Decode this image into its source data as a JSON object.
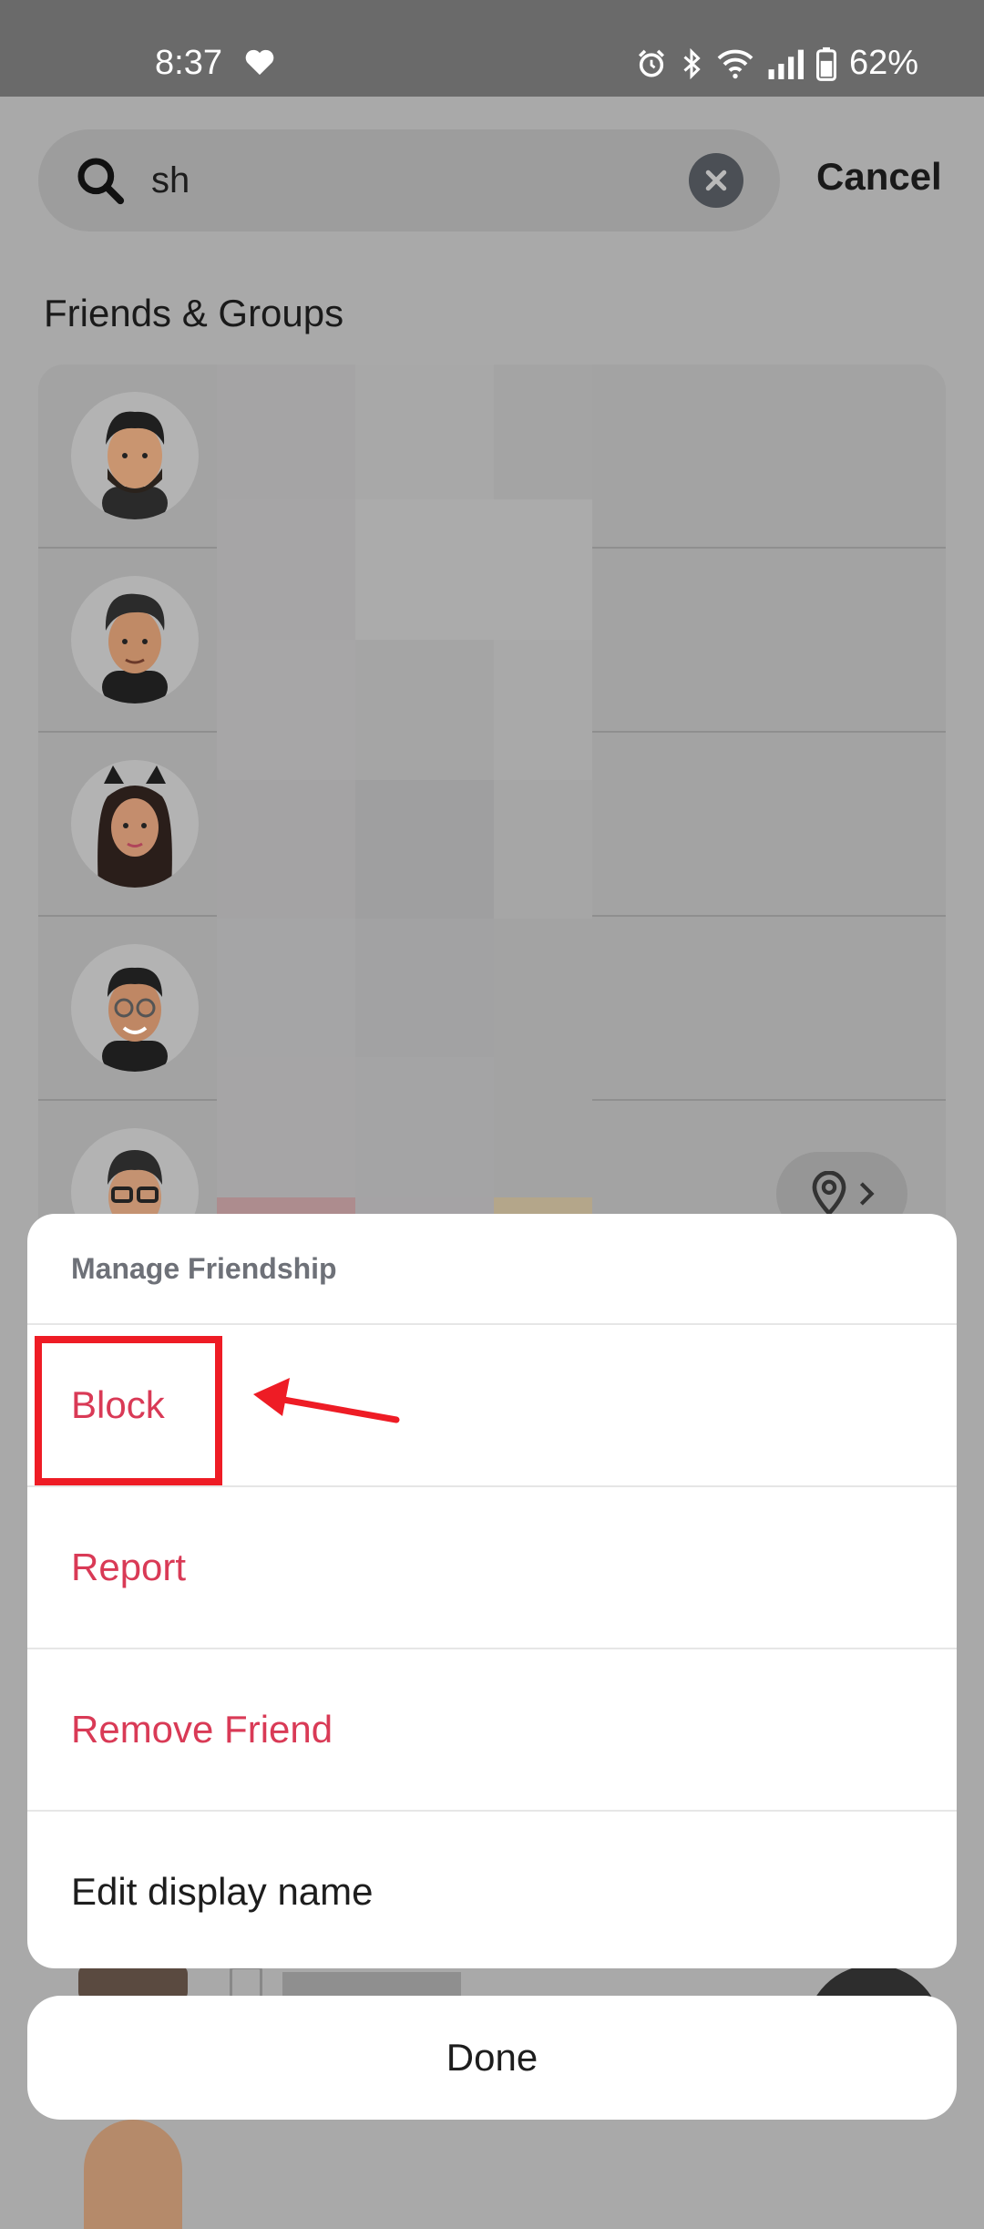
{
  "status_bar": {
    "time": "8:37",
    "battery": "62%",
    "icons": [
      "heart-icon",
      "alarm-icon",
      "bluetooth-icon",
      "wifi-icon",
      "signal-icon",
      "battery-icon"
    ]
  },
  "search": {
    "query": "sh",
    "cancel_label": "Cancel"
  },
  "friends_section": {
    "title": "Friends & Groups"
  },
  "action_sheet": {
    "title": "Manage Friendship",
    "items": [
      {
        "label": "Block"
      },
      {
        "label": "Report"
      },
      {
        "label": "Remove Friend"
      },
      {
        "label": "Edit display name"
      }
    ]
  },
  "done_label": "Done",
  "colors": {
    "danger": "#d93a56",
    "annotation": "#ee1c25"
  }
}
